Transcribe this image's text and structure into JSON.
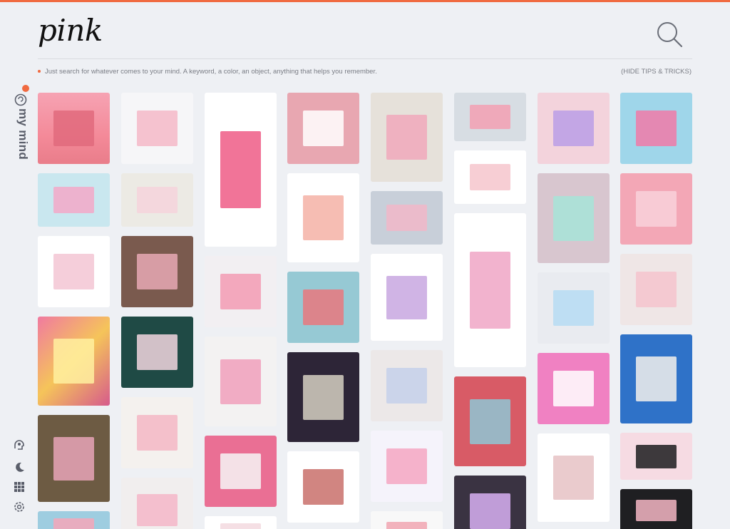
{
  "search": {
    "query": "pink"
  },
  "tips": {
    "text": "Just search for whatever comes to your mind. A keyword, a color, an object, anything that helps you remember.",
    "hide_label": "(HIDE TIPS & TRICKS)"
  },
  "brand": {
    "name": "my mind"
  },
  "colors": {
    "accent": "#f06a40",
    "background": "#eef0f4",
    "text": "#555555"
  },
  "sidebar_icons": [
    "head-icon",
    "moon-icon",
    "grid-icon",
    "gear-icon"
  ],
  "columns": [
    [
      {
        "name": "pink-building",
        "bg": "linear-gradient(180deg,#f6a3b3 0%,#f48a99 60%,#e97d8a 100%)",
        "art": "#e06a7c"
      },
      {
        "name": "pink-tiles",
        "bg": "#c9e7ef",
        "art": "#f3a8c8"
      },
      {
        "name": "tote-bags",
        "bg": "#ffffff",
        "art": "#f3c6d4"
      },
      {
        "name": "flowers",
        "bg": "linear-gradient(135deg,#f07aa0,#f5c45a,#d65a8c)",
        "art": "#fff0a0"
      },
      {
        "name": "balcony",
        "bg": "#6d5b43",
        "art": "#e7a4b7"
      },
      {
        "name": "blue-print",
        "bg": "#9ecde0",
        "art": "#f4a6b8"
      }
    ],
    [
      {
        "name": "japanese-poster",
        "bg": "#f6f6f8",
        "art": "#f5b8c8"
      },
      {
        "name": "pastel-candy",
        "bg": "#eceae4",
        "art": "#f6d3dc"
      },
      {
        "name": "pink-room",
        "bg": "#7a5a4e",
        "art": "#e8a9b5"
      },
      {
        "name": "rings-nails",
        "bg": "#1f4a45",
        "art": "#f2d6df"
      },
      {
        "name": "phone-cases",
        "bg": "#f4f1ee",
        "art": "#f3b7c4"
      },
      {
        "name": "fashion-woman",
        "bg": "#f1eeee",
        "art": "#f4b6c8"
      }
    ],
    [
      {
        "name": "pink-magazine",
        "bg": "#ffffff",
        "art": "#ee5c86"
      },
      {
        "name": "pink-green-bags",
        "bg": "#f2eff2",
        "art": "#f39bb4"
      },
      {
        "name": "pink-coat",
        "bg": "#f3f2f2",
        "art": "#f0a0bc"
      },
      {
        "name": "pink-outfit",
        "bg": "#ea6f94",
        "art": "#f6f6f6"
      },
      {
        "name": "white-tile",
        "bg": "#ffffff",
        "art": "#f3d9df"
      }
    ],
    [
      {
        "name": "tea-table",
        "bg": "#e8a7b1",
        "art": "#ffffff"
      },
      {
        "name": "collage-grid",
        "bg": "#ffffff",
        "art": "#f5b1a6"
      },
      {
        "name": "lingerie",
        "bg": "#96c9d4",
        "art": "#e9787e"
      },
      {
        "name": "book-cover",
        "bg": "#2d2537",
        "art": "#d6d0c2"
      },
      {
        "name": "clothes-rack",
        "bg": "#ffffff",
        "art": "#c9706b"
      }
    ],
    [
      {
        "name": "lying-woman",
        "bg": "#e6e1da",
        "art": "#f0a8bb"
      },
      {
        "name": "glass-domes",
        "bg": "#c8cfd9",
        "art": "#f1b7c8"
      },
      {
        "name": "earrings",
        "bg": "#ffffff",
        "art": "#c8a7e0"
      },
      {
        "name": "dolls",
        "bg": "#ece8e8",
        "art": "#c6d0ea"
      },
      {
        "name": "confetti",
        "bg": "#f5f3fb",
        "art": "#f5a6c2"
      },
      {
        "name": "pink-card",
        "bg": "#f8f8f8",
        "art": "#f1a6b2"
      }
    ],
    [
      {
        "name": "balloon-street",
        "bg": "#d7dde3",
        "art": "#f3a0b3"
      },
      {
        "name": "figurines",
        "bg": "#ffffff",
        "art": "#f6c6cd"
      },
      {
        "name": "clothes-collage",
        "bg": "#ffffff",
        "art": "#f0a6c5"
      },
      {
        "name": "colorful-shapes",
        "bg": "#d85b66",
        "art": "#8fc7d5"
      },
      {
        "name": "purple-shoes",
        "bg": "#3a3342",
        "art": "#d8b0f2"
      }
    ],
    [
      {
        "name": "pink-socks",
        "bg": "#f3d3dc",
        "art": "#ba9ee6"
      },
      {
        "name": "rainbow-hair",
        "bg": "#d8c6cf",
        "art": "#a7e4d8"
      },
      {
        "name": "crystals",
        "bg": "#e9ebf0",
        "art": "#b6dcf3"
      },
      {
        "name": "pattern-pink",
        "bg": "#f081c2",
        "art": "#ffffff"
      },
      {
        "name": "white-dress",
        "bg": "#ffffff",
        "art": "#e6c2c4"
      }
    ],
    [
      {
        "name": "anime-boxes",
        "bg": "#9fd6ea",
        "art": "#f07aa8"
      },
      {
        "name": "pink-pillow",
        "bg": "#f3a7b6",
        "art": "#f8d1da"
      },
      {
        "name": "cards",
        "bg": "#efe6e6",
        "art": "#f5c3cc"
      },
      {
        "name": "blue-frame",
        "bg": "#2f72c8",
        "art": "#f2f0ec"
      },
      {
        "name": "bows",
        "bg": "#f6dbe3",
        "art": "#1c1c1e"
      },
      {
        "name": "plates",
        "bg": "#1f1f22",
        "art": "#f5b6c3"
      }
    ]
  ]
}
